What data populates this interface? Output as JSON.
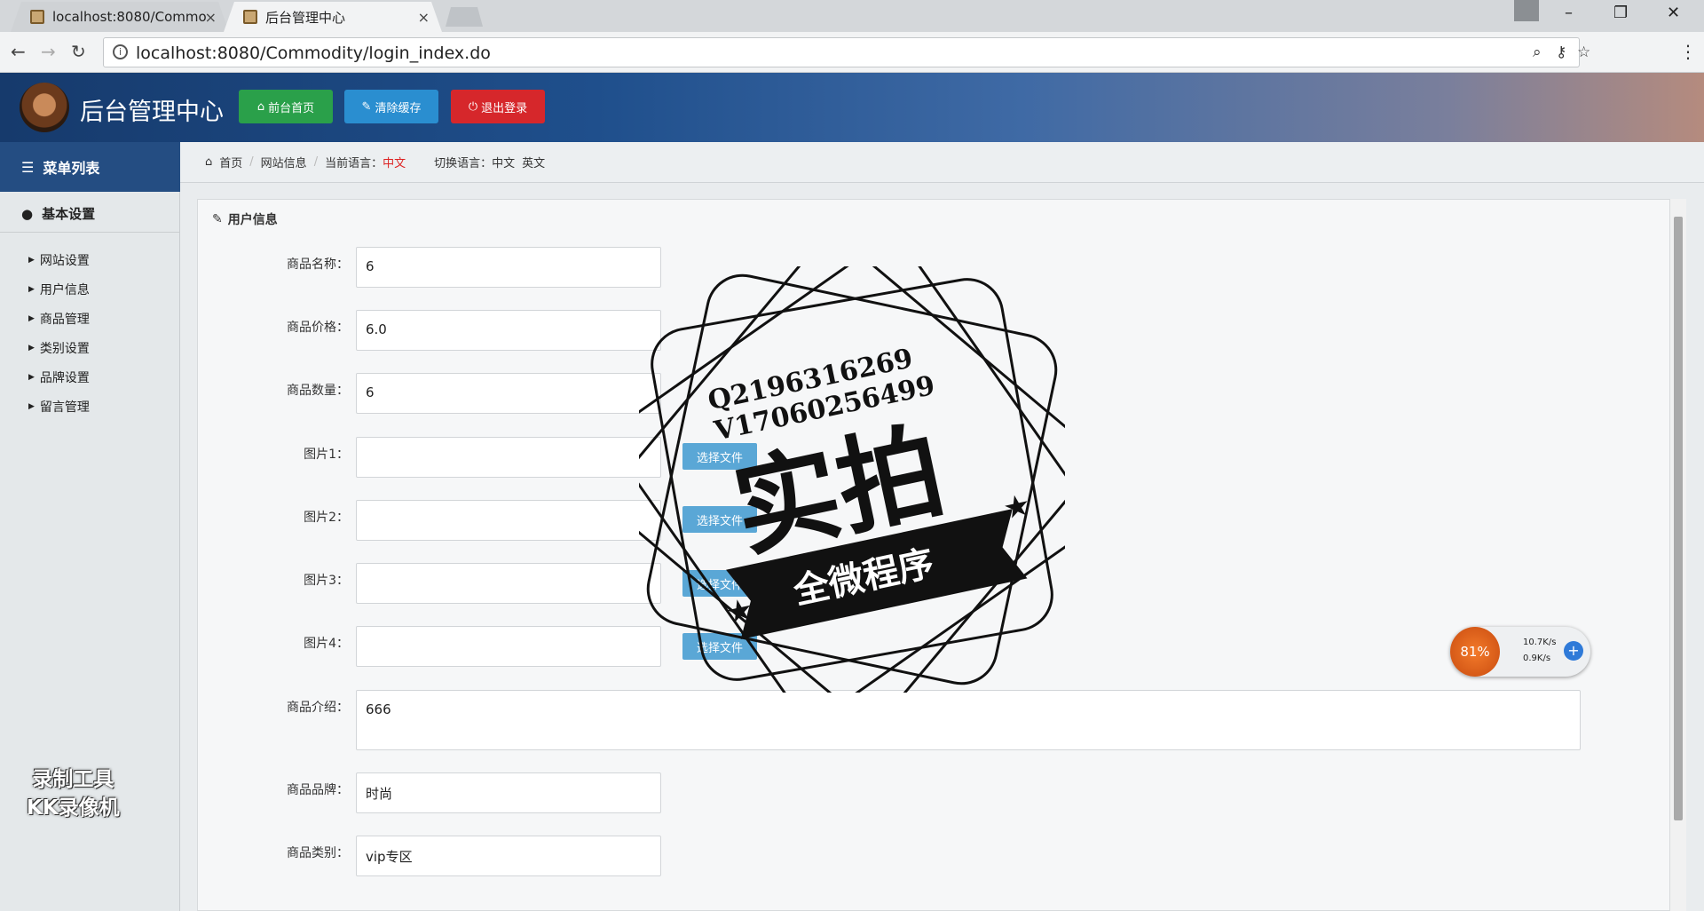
{
  "browser": {
    "tabs": [
      {
        "title": "localhost:8080/Commo"
      },
      {
        "title": "后台管理中心"
      }
    ],
    "url": "localhost:8080/Commodity/login_index.do"
  },
  "header": {
    "title": "后台管理中心",
    "buttons": {
      "home": "前台首页",
      "cache": "清除缓存",
      "logout": "退出登录"
    }
  },
  "sidebar": {
    "menu_title": "菜单列表",
    "section": "基本设置",
    "items": [
      {
        "label": "网站设置"
      },
      {
        "label": "用户信息"
      },
      {
        "label": "商品管理"
      },
      {
        "label": "类别设置"
      },
      {
        "label": "品牌设置"
      },
      {
        "label": "留言管理"
      }
    ],
    "watermark": {
      "line1": "录制工具",
      "line2": "KK录像机"
    }
  },
  "breadcrumb": {
    "home": "首页",
    "page": "网站信息",
    "current_lang_label": "当前语言：",
    "current_lang": "中文",
    "switch_label": "切换语言：",
    "lang_zh": "中文",
    "lang_en": "英文"
  },
  "panel": {
    "title": "用户信息",
    "fields": {
      "name": {
        "label": "商品名称：",
        "value": "6"
      },
      "price": {
        "label": "商品价格：",
        "value": "6.0"
      },
      "qty": {
        "label": "商品数量：",
        "value": "6"
      },
      "img1": {
        "label": "图片1：",
        "button": "选择文件"
      },
      "img2": {
        "label": "图片2：",
        "button": "选择文件"
      },
      "img3": {
        "label": "图片3：",
        "button": "选择文件"
      },
      "img4": {
        "label": "图片4：",
        "button": "选择文件"
      },
      "intro": {
        "label": "商品介绍：",
        "value": "666"
      },
      "brand": {
        "label": "商品品牌：",
        "value": "时尚"
      },
      "category": {
        "label": "商品类别：",
        "value": "vip专区"
      }
    }
  },
  "speed_widget": {
    "percent": "81%",
    "up": "10.7K/s",
    "down": "0.9K/s"
  },
  "stamp": {
    "line1": "Q2196316269",
    "line2": "V17060256499",
    "main": "实拍",
    "banner": "全微程序"
  }
}
